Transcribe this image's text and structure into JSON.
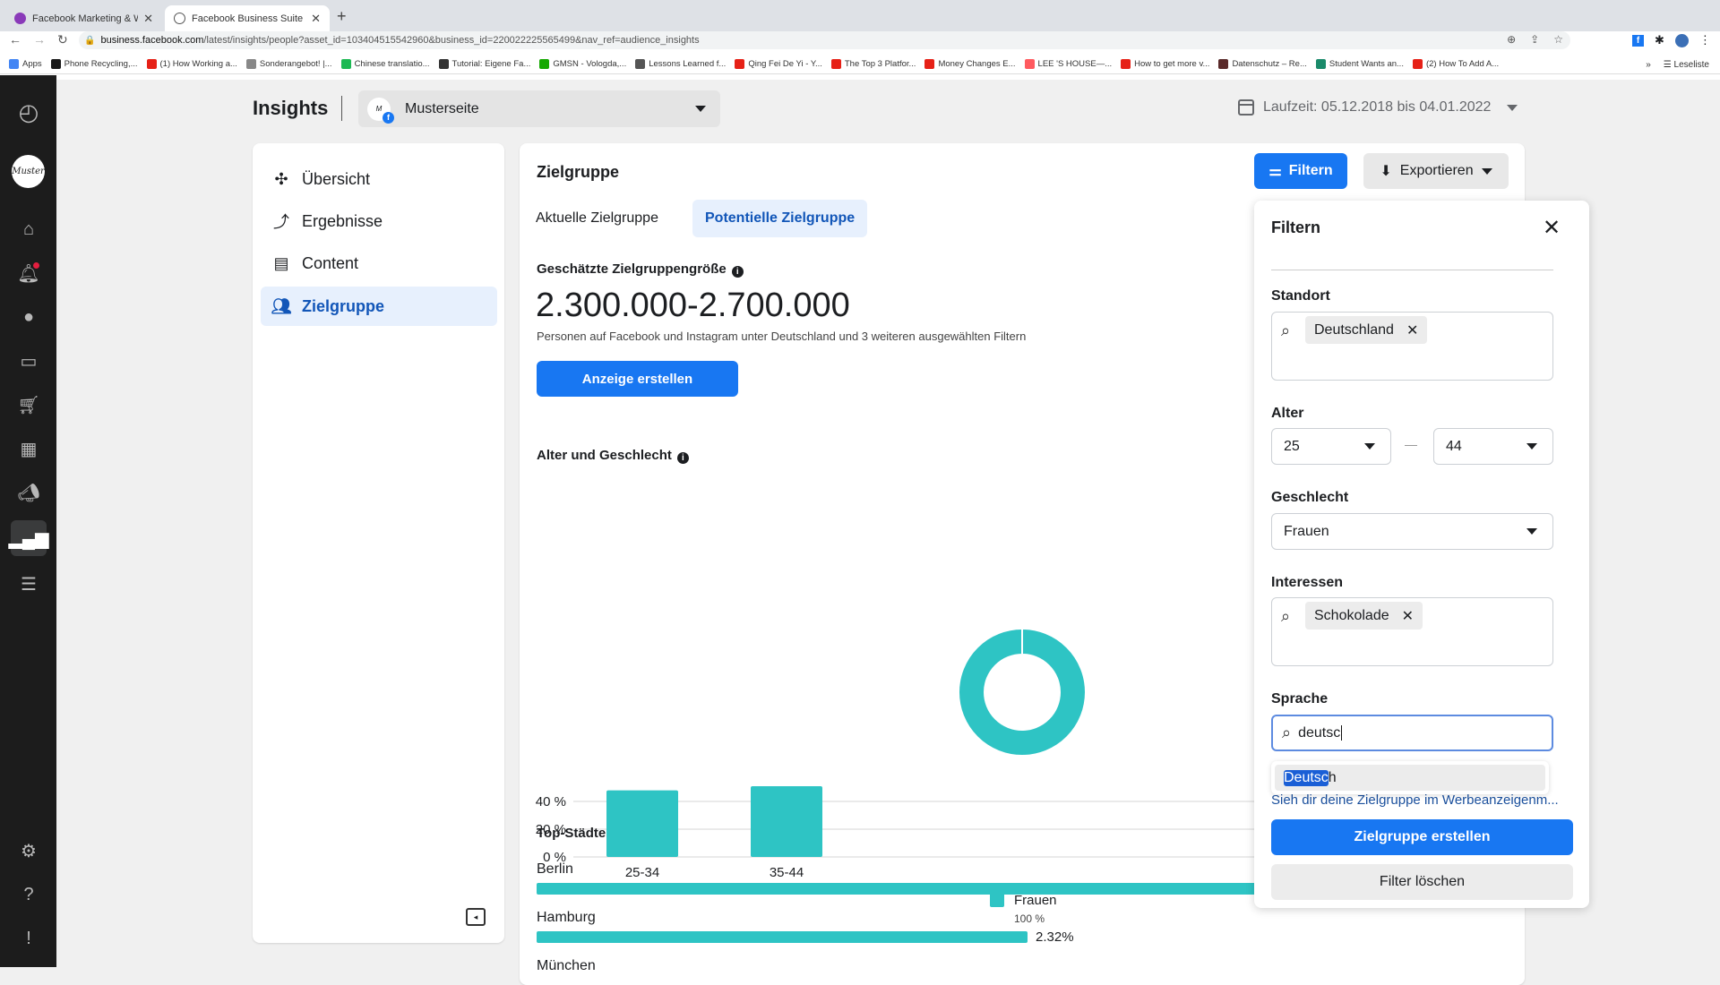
{
  "browser": {
    "tabs": [
      {
        "label": "Facebook Marketing & Werbea",
        "active": false,
        "favicon_color": "#8a3ab9"
      },
      {
        "label": "Facebook Business Suite",
        "active": true
      }
    ],
    "url_domain": "business.facebook.com",
    "url_path": "/latest/insights/people?asset_id=103404515542960&business_id=220022225565499&nav_ref=audience_insights",
    "bookmarks": [
      {
        "label": "Apps",
        "color": "#4285f4"
      },
      {
        "label": "Phone Recycling,...",
        "color": "#1a1a1a"
      },
      {
        "label": "(1) How Working a...",
        "color": "#e62117"
      },
      {
        "label": "Sonderangebot! |...",
        "color": "#888888"
      },
      {
        "label": "Chinese translatio...",
        "color": "#1db954"
      },
      {
        "label": "Tutorial: Eigene Fa...",
        "color": "#333333"
      },
      {
        "label": "GMSN - Vologda,...",
        "color": "#14a800"
      },
      {
        "label": "Lessons Learned f...",
        "color": "#555555"
      },
      {
        "label": "Qing Fei De Yi - Y...",
        "color": "#e62117"
      },
      {
        "label": "The Top 3 Platfor...",
        "color": "#e62117"
      },
      {
        "label": "Money Changes E...",
        "color": "#e62117"
      },
      {
        "label": "LEE 'S HOUSE—...",
        "color": "#ff5a5f"
      },
      {
        "label": "How to get more v...",
        "color": "#e62117"
      },
      {
        "label": "Datenschutz – Re...",
        "color": "#5a2a2a"
      },
      {
        "label": "Student Wants an...",
        "color": "#1a8a6a"
      },
      {
        "label": "(2) How To Add A...",
        "color": "#e62117"
      }
    ],
    "more_bookmarks": "»",
    "reading_list": "Leseliste"
  },
  "rail": {
    "avatar_text": "Muster",
    "items": [
      "business-suite-logo",
      "home",
      "notifications",
      "messages",
      "posts",
      "shop",
      "planner",
      "ads",
      "insights",
      "menu",
      "settings",
      "help",
      "feedback"
    ]
  },
  "header": {
    "title": "Insights",
    "page_name": "Musterseite",
    "daterange": "Laufzeit: 05.12.2018 bis 04.01.2022"
  },
  "nav": {
    "items": [
      {
        "label": "Übersicht",
        "icon": "⚛"
      },
      {
        "label": "Ergebnisse",
        "icon": "〰"
      },
      {
        "label": "Content",
        "icon": "▤"
      },
      {
        "label": "Zielgruppe",
        "icon": "👥",
        "active": true
      }
    ]
  },
  "main": {
    "title": "Zielgruppe",
    "tabs": [
      "Aktuelle Zielgruppe",
      "Potentielle Zielgruppe"
    ],
    "active_tab": "Potentielle Zielgruppe",
    "estimate_label": "Geschätzte Zielgruppengröße",
    "estimate_value": "2.300.000-2.700.000",
    "estimate_desc": "Personen auf Facebook und Instagram unter Deutschland und 3 weiteren ausgewählten Filtern",
    "cta": "Anzeige erstellen",
    "age_gender_title": "Alter und Geschlecht",
    "filter_btn": "Filtern",
    "export_btn": "Exportieren",
    "cities_title": "Top-Städte",
    "cities": [
      {
        "name": "Berlin",
        "share_pct": null
      },
      {
        "name": "Hamburg",
        "share_pct": 2.32,
        "label": "2.32%"
      },
      {
        "name": "München",
        "share_pct": null
      }
    ]
  },
  "chart_data": [
    {
      "type": "pie",
      "title": "Alter und Geschlecht",
      "categories": [
        "Frauen"
      ],
      "values": [
        100
      ],
      "legend": [
        {
          "name": "Frauen",
          "label": "100 %",
          "color": "#2ec4c4"
        }
      ],
      "legend_position": "bottom"
    },
    {
      "type": "bar",
      "categories": [
        "25-34",
        "35-44"
      ],
      "values": [
        48,
        51
      ],
      "ylabel": "",
      "xlabel": "",
      "yticks": [
        "0 %",
        "20 %",
        "40 %"
      ],
      "ylim": [
        0,
        60
      ],
      "color": "#2ec4c4",
      "grid": true
    }
  ],
  "filter_panel": {
    "title": "Filtern",
    "location_label": "Standort",
    "location_chip": "Deutschland",
    "age_label": "Alter",
    "age_min": "25",
    "age_max": "44",
    "gender_label": "Geschlecht",
    "gender_value": "Frauen",
    "interests_label": "Interessen",
    "interest_chip": "Schokolade",
    "language_label": "Sprache",
    "language_query": "deutsc",
    "suggestion_highlight": "Deutsc",
    "suggestion_rest": "h",
    "ads_manager_link": "Sieh dir deine Zielgruppe im Werbeanzeigenm...",
    "create_btn": "Zielgruppe erstellen",
    "clear_btn": "Filter löschen"
  }
}
